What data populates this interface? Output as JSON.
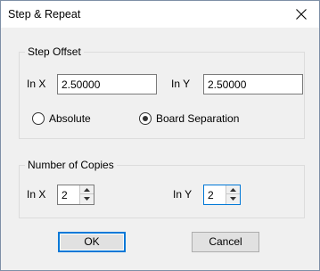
{
  "window": {
    "title": "Step & Repeat",
    "close_symbol": "×"
  },
  "step_offset": {
    "group_label": "Step Offset",
    "in_x_label": "In X",
    "in_x_value": "2.50000",
    "in_y_label": "In Y",
    "in_y_value": "2.50000",
    "mode_options": [
      {
        "label": "Absolute",
        "selected": false
      },
      {
        "label": "Board Separation",
        "selected": true
      }
    ]
  },
  "copies": {
    "group_label": "Number of Copies",
    "in_x_label": "In X",
    "in_x_value": "2",
    "in_y_label": "In Y",
    "in_y_value": "2"
  },
  "buttons": {
    "ok_label": "OK",
    "cancel_label": "Cancel"
  },
  "colors": {
    "focus_accent": "#0078d7",
    "dialog_background": "#f0f0f0"
  }
}
